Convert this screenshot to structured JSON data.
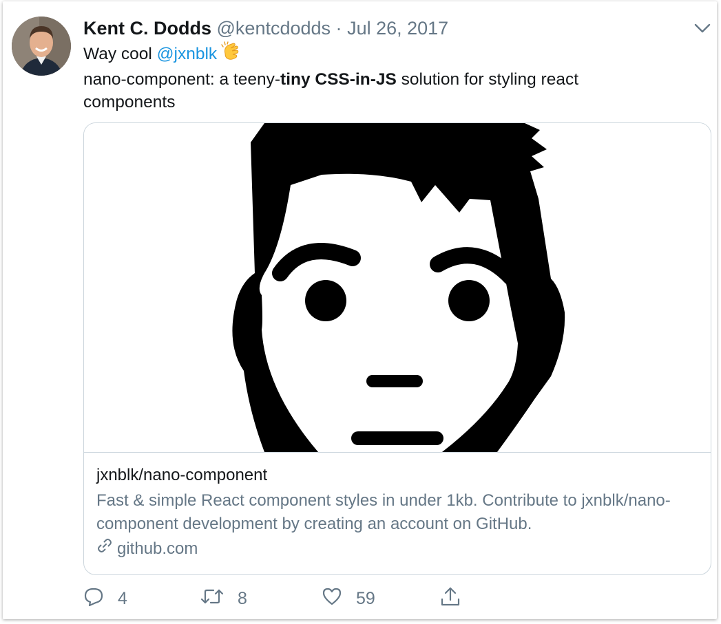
{
  "tweet": {
    "author_name": "Kent C. Dodds",
    "handle": "@kentcdodds",
    "separator": "·",
    "date": "Jul 26, 2017",
    "text_prefix": "Way cool ",
    "mention": "@jxnblk",
    "line2_a": "nano-component: a teeny-",
    "line2_b": "tiny CSS-in-JS",
    "line2_c": " solution for styling react",
    "line3": "components"
  },
  "card": {
    "title": "jxnblk/nano-component",
    "description": "Fast & simple React component styles in under 1kb. Contribute to jxnblk/nano-component development by creating an account on GitHub.",
    "domain": "github.com"
  },
  "actions": {
    "reply_count": "4",
    "retweet_count": "8",
    "like_count": "59"
  },
  "icons": {
    "reply": "reply-icon",
    "retweet": "retweet-icon",
    "like": "heart-icon",
    "share": "share-icon",
    "link": "link-icon",
    "caret": "chevron-down-icon",
    "emoji": "clapping-hands-emoji"
  },
  "colors": {
    "link_blue": "#1b95e0",
    "secondary_text": "#657786",
    "border": "#ccd6dd"
  }
}
